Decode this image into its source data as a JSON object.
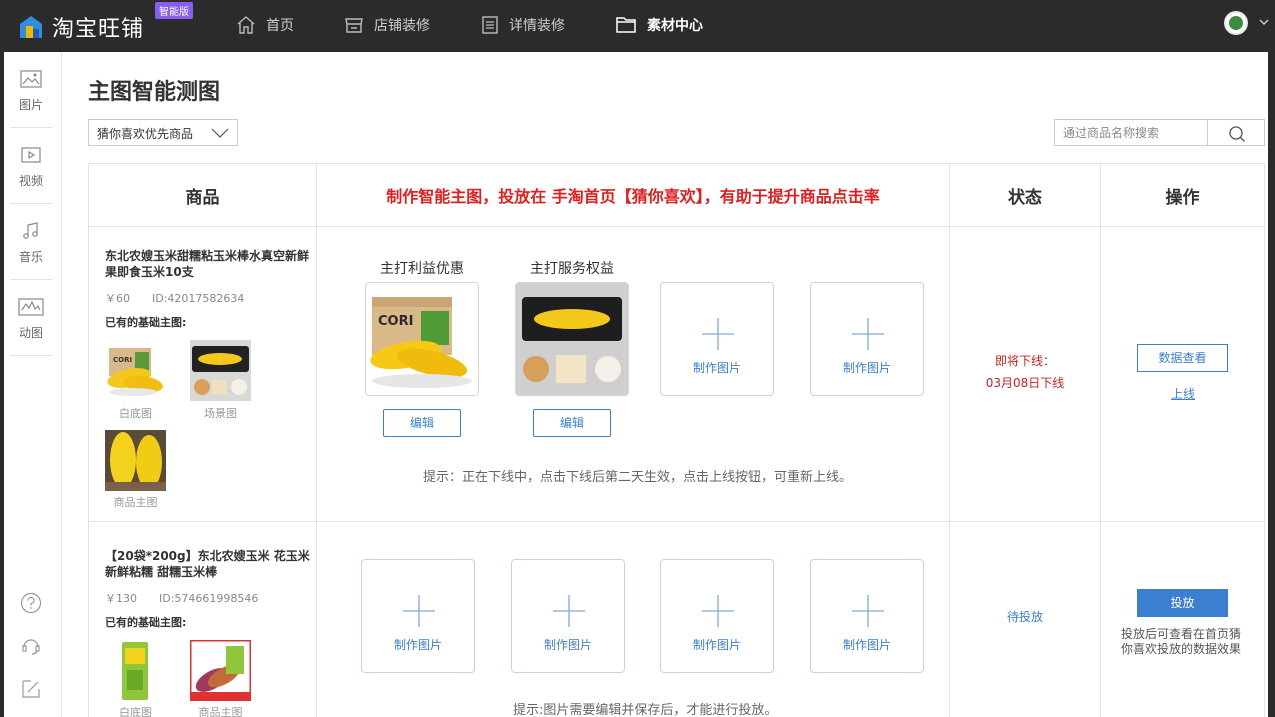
{
  "topbar": {
    "logo_text": "淘宝旺铺",
    "logo_badge": "智能版",
    "nav": [
      {
        "label": "首页",
        "icon": "home-icon"
      },
      {
        "label": "店铺装修",
        "icon": "store-icon"
      },
      {
        "label": "详情装修",
        "icon": "document-icon"
      },
      {
        "label": "素材中心",
        "icon": "folder-icon",
        "active": true
      }
    ]
  },
  "sidebar": {
    "items": [
      {
        "label": "图片",
        "icon": "image-icon"
      },
      {
        "label": "视频",
        "icon": "video-icon"
      },
      {
        "label": "音乐",
        "icon": "music-icon"
      },
      {
        "label": "动图",
        "icon": "gif-icon"
      }
    ],
    "bottom_icons": [
      "help-icon",
      "customer-service-icon",
      "feedback-edit-icon"
    ]
  },
  "main": {
    "title": "主图智能测图",
    "filter_select": "猜你喜欢优先商品",
    "search": {
      "placeholder": "通过商品名称搜索",
      "value": ""
    }
  },
  "table": {
    "headers": {
      "product": "商品",
      "promo": "制作智能主图，投放在 手淘首页【猜你喜欢】，有助于提升商品点击率",
      "status": "状态",
      "action": "操作"
    },
    "rows": [
      {
        "title": "东北农嫂玉米甜糯粘玉米棒水真空新鲜果即食玉米10支",
        "price": "￥60",
        "id": "ID:42017582634",
        "base_label": "已有的基础主图:",
        "thumbs": [
          "白底图",
          "场景图",
          "商品主图"
        ],
        "image_titles": [
          "主打利益优惠",
          "主打服务权益"
        ],
        "edit_label": "编辑",
        "make_label": "制作图片",
        "tip": "提示：正在下线中，点击下线后第二天生效，点击上线按钮，可重新上线。",
        "status_line1": "即将下线：",
        "status_line2": "03月08日下线",
        "action_button": "数据查看",
        "action_link": "上线"
      },
      {
        "title": "【20袋*200g】东北农嫂玉米 花玉米新鲜粘糯 甜糯玉米棒",
        "price": "￥130",
        "id": "ID:574661998546",
        "base_label": "已有的基础主图:",
        "thumbs": [
          "白底图",
          "商品主图"
        ],
        "make_label": "制作图片",
        "tip": "提示:图片需要编辑并保存后，才能进行投放。",
        "status": "待投放",
        "action_button": "投放",
        "action_note": "投放后可查看在首页猜你喜欢投放的数据效果"
      }
    ]
  },
  "colors": {
    "accent": "#3a7fd0",
    "alert": "#d02020",
    "topbar": "#2b2b2b",
    "badge": "#8a5cf0"
  }
}
